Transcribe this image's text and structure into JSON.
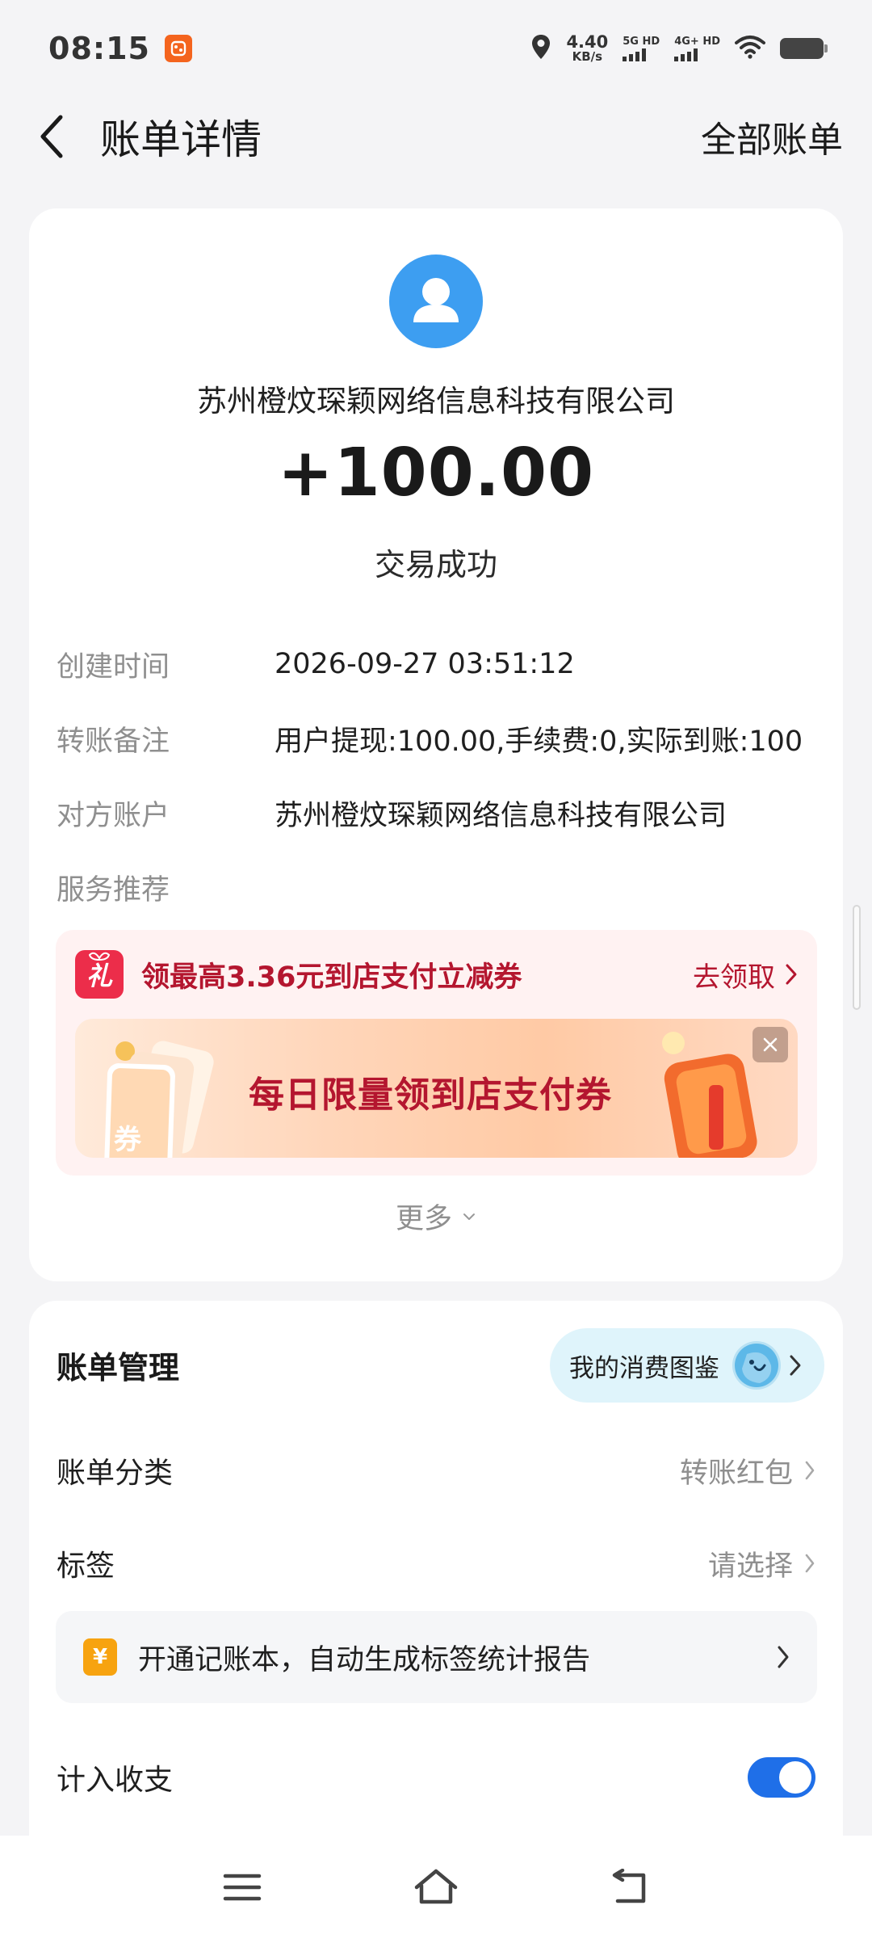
{
  "status_bar": {
    "time": "08:15",
    "net_speed_value": "4.40",
    "net_speed_unit": "KB/s",
    "sim1_label": "5G HD",
    "sim2_label": "4G+ HD",
    "icons": [
      "app-badge-icon",
      "location-icon",
      "signal-icon",
      "wifi-icon",
      "battery-icon"
    ]
  },
  "header": {
    "title": "账单详情",
    "all_bills": "全部账单",
    "back_icon": "chevron-left-icon"
  },
  "transaction": {
    "merchant": "苏州橙炆琛颖网络信息科技有限公司",
    "amount": "+100.00",
    "status": "交易成功",
    "avatar_icon": "user-icon",
    "avatar_color": "#3d9ef1"
  },
  "details": [
    {
      "label": "创建时间",
      "value": "2026-09-27 03:51:12"
    },
    {
      "label": "转账备注",
      "value": "用户提现:100.00,手续费:0,实际到账:100"
    },
    {
      "label": "对方账户",
      "value": "苏州橙炆琛颖网络信息科技有限公司"
    },
    {
      "label": "服务推荐",
      "value": ""
    }
  ],
  "promo": {
    "gift_glyph": "礼",
    "text": "领最高3.36元到店支付立减券",
    "action": "去领取",
    "banner_text": "每日限量领到店支付券",
    "ticket_glyph": "券",
    "accent": "#b4162f"
  },
  "more": {
    "label": "更多"
  },
  "management": {
    "title": "账单管理",
    "atlas_label": "我的消费图鉴",
    "category_label": "账单分类",
    "category_value": "转账红包",
    "tag_label": "标签",
    "tag_value": "请选择",
    "ledger_icon_glyph": "¥",
    "ledger_text": "开通记账本，自动生成标签统计报告",
    "income_label": "计入收支",
    "income_enabled": true,
    "toggle_color": "#1f6fe8"
  },
  "nav": {
    "icons": [
      "menu-icon",
      "home-icon",
      "back-icon"
    ]
  }
}
